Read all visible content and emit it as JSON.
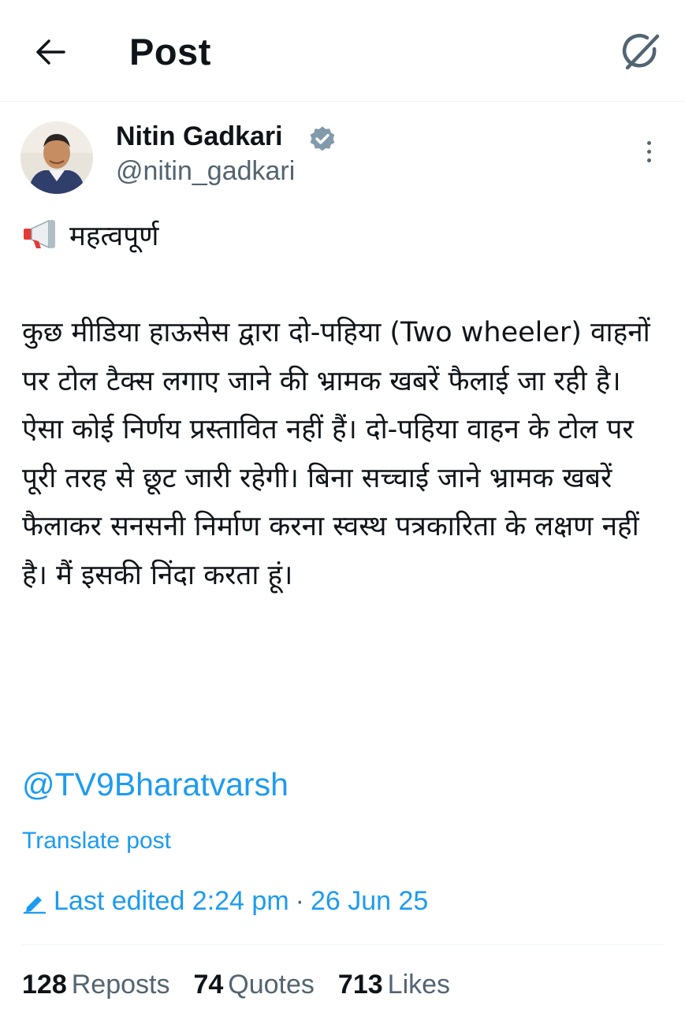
{
  "header": {
    "title": "Post",
    "back_icon": "arrow-left-icon",
    "grok_icon": "grok-icon"
  },
  "author": {
    "name": "Nitin Gadkari",
    "handle": "@nitin_gadkari",
    "verified_icon": "verified-badge-icon"
  },
  "post": {
    "heading_emoji": "megaphone-icon",
    "heading": "महत्वपूर्ण",
    "body": "कुछ मीडिया हाऊसेस  द्वारा दो-पहिया (Two wheeler) वाहनों पर टोल टैक्स लगाए जाने की भ्रामक खबरें फैलाई जा रही है। ऐसा कोई निर्णय प्रस्तावित नहीं हैं। दो-पहिया वाहन के टोल पर पूरी तरह से छूट जारी रहेगी। बिना सच्चाई जाने भ्रामक खबरें फैलाकर सनसनी निर्माण करना स्वस्थ पत्रकारिता के लक्षण नहीं है। मैं इसकी निंदा करता हूं।",
    "mention": "@TV9Bharatvarsh",
    "translate": "Translate post",
    "edited_label": "Last edited 2:24 pm",
    "separator": "·",
    "date": "26 Jun 25"
  },
  "stats": {
    "reposts_count": "128",
    "reposts_label": "Reposts",
    "quotes_count": "74",
    "quotes_label": "Quotes",
    "likes_count": "713",
    "likes_label": "Likes"
  },
  "colors": {
    "accent": "#1d9bf0",
    "secondary": "#536471",
    "text": "#0f1419",
    "divider": "#eff3f4"
  }
}
